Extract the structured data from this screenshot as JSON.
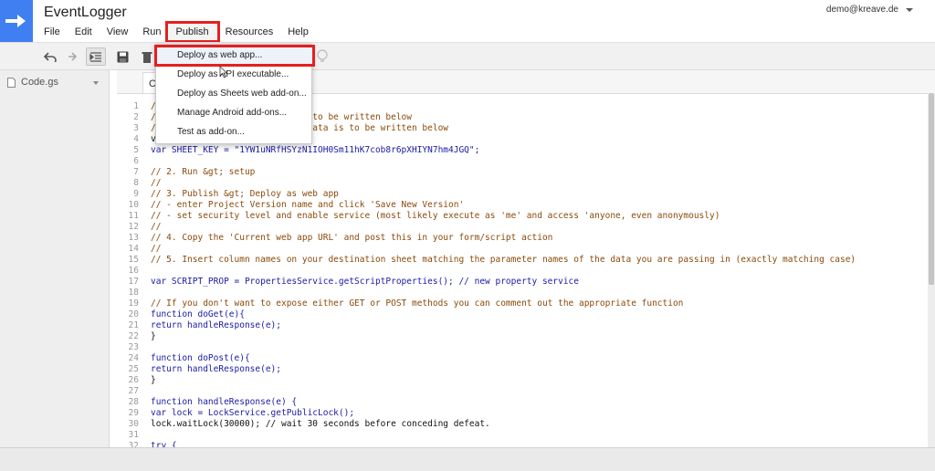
{
  "header": {
    "title": "EventLogger",
    "user_email": "demo@kreave.de"
  },
  "menubar": {
    "items": [
      "File",
      "Edit",
      "View",
      "Run",
      "Publish",
      "Resources",
      "Help"
    ]
  },
  "toolbar": {
    "icons": [
      "undo-icon",
      "redo-icon",
      "indent-icon",
      "save-icon",
      "trash-icon",
      "bulb-icon"
    ]
  },
  "sidebar": {
    "file_name": "Code.gs"
  },
  "editor": {
    "tab_label": "C"
  },
  "publish_menu": {
    "items": [
      "Deploy as web app...",
      "Deploy as API executable...",
      "Deploy as Sheets web add-on...",
      "Manage Android add-ons...",
      "Test as add-on..."
    ]
  },
  "code": {
    "lines": [
      {
        "n": "1",
        "text": "/"
      },
      {
        "n": "2",
        "text": "/                         a is to be written below"
      },
      {
        "n": "3",
        "text": "/                        here data is to be written below"
      },
      {
        "n": "4",
        "text": "v"
      },
      {
        "n": "5",
        "text": "var SHEET_KEY = \"1YW1uNRfHSYzN1IOH0Sm11hK7cob8r6pXHIYN7hm4JGQ\";"
      },
      {
        "n": "6",
        "text": ""
      },
      {
        "n": "7",
        "text": "// 2. Run &gt; setup"
      },
      {
        "n": "8",
        "text": "//"
      },
      {
        "n": "9",
        "text": "// 3. Publish &gt; Deploy as web app"
      },
      {
        "n": "10",
        "text": "// - enter Project Version name and click 'Save New Version'"
      },
      {
        "n": "11",
        "text": "// - set security level and enable service (most likely execute as 'me' and access 'anyone, even anonymously)"
      },
      {
        "n": "12",
        "text": "//"
      },
      {
        "n": "13",
        "text": "// 4. Copy the 'Current web app URL' and post this in your form/script action"
      },
      {
        "n": "14",
        "text": "//"
      },
      {
        "n": "15",
        "text": "// 5. Insert column names on your destination sheet matching the parameter names of the data you are passing in (exactly matching case)"
      },
      {
        "n": "16",
        "text": ""
      },
      {
        "n": "17",
        "text": "var SCRIPT_PROP = PropertiesService.getScriptProperties(); // new property service"
      },
      {
        "n": "18",
        "text": ""
      },
      {
        "n": "19",
        "text": "// If you don't want to expose either GET or POST methods you can comment out the appropriate function"
      },
      {
        "n": "20",
        "text": "function doGet(e){"
      },
      {
        "n": "21",
        "text": "return handleResponse(e);"
      },
      {
        "n": "22",
        "text": "}"
      },
      {
        "n": "23",
        "text": ""
      },
      {
        "n": "24",
        "text": "function doPost(e){"
      },
      {
        "n": "25",
        "text": "return handleResponse(e);"
      },
      {
        "n": "26",
        "text": "}"
      },
      {
        "n": "27",
        "text": ""
      },
      {
        "n": "28",
        "text": "function handleResponse(e) {"
      },
      {
        "n": "29",
        "text": "var lock = LockService.getPublicLock();"
      },
      {
        "n": "30",
        "text": "lock.waitLock(30000); // wait 30 seconds before conceding defeat."
      },
      {
        "n": "31",
        "text": ""
      },
      {
        "n": "32",
        "text": "try {"
      }
    ]
  },
  "colors": {
    "logo_blue": "#3f7ff2",
    "highlight_red": "#e41f1f",
    "comment": "#8a4a0b",
    "keyword": "#1a1aa6",
    "string": "#a31515"
  }
}
